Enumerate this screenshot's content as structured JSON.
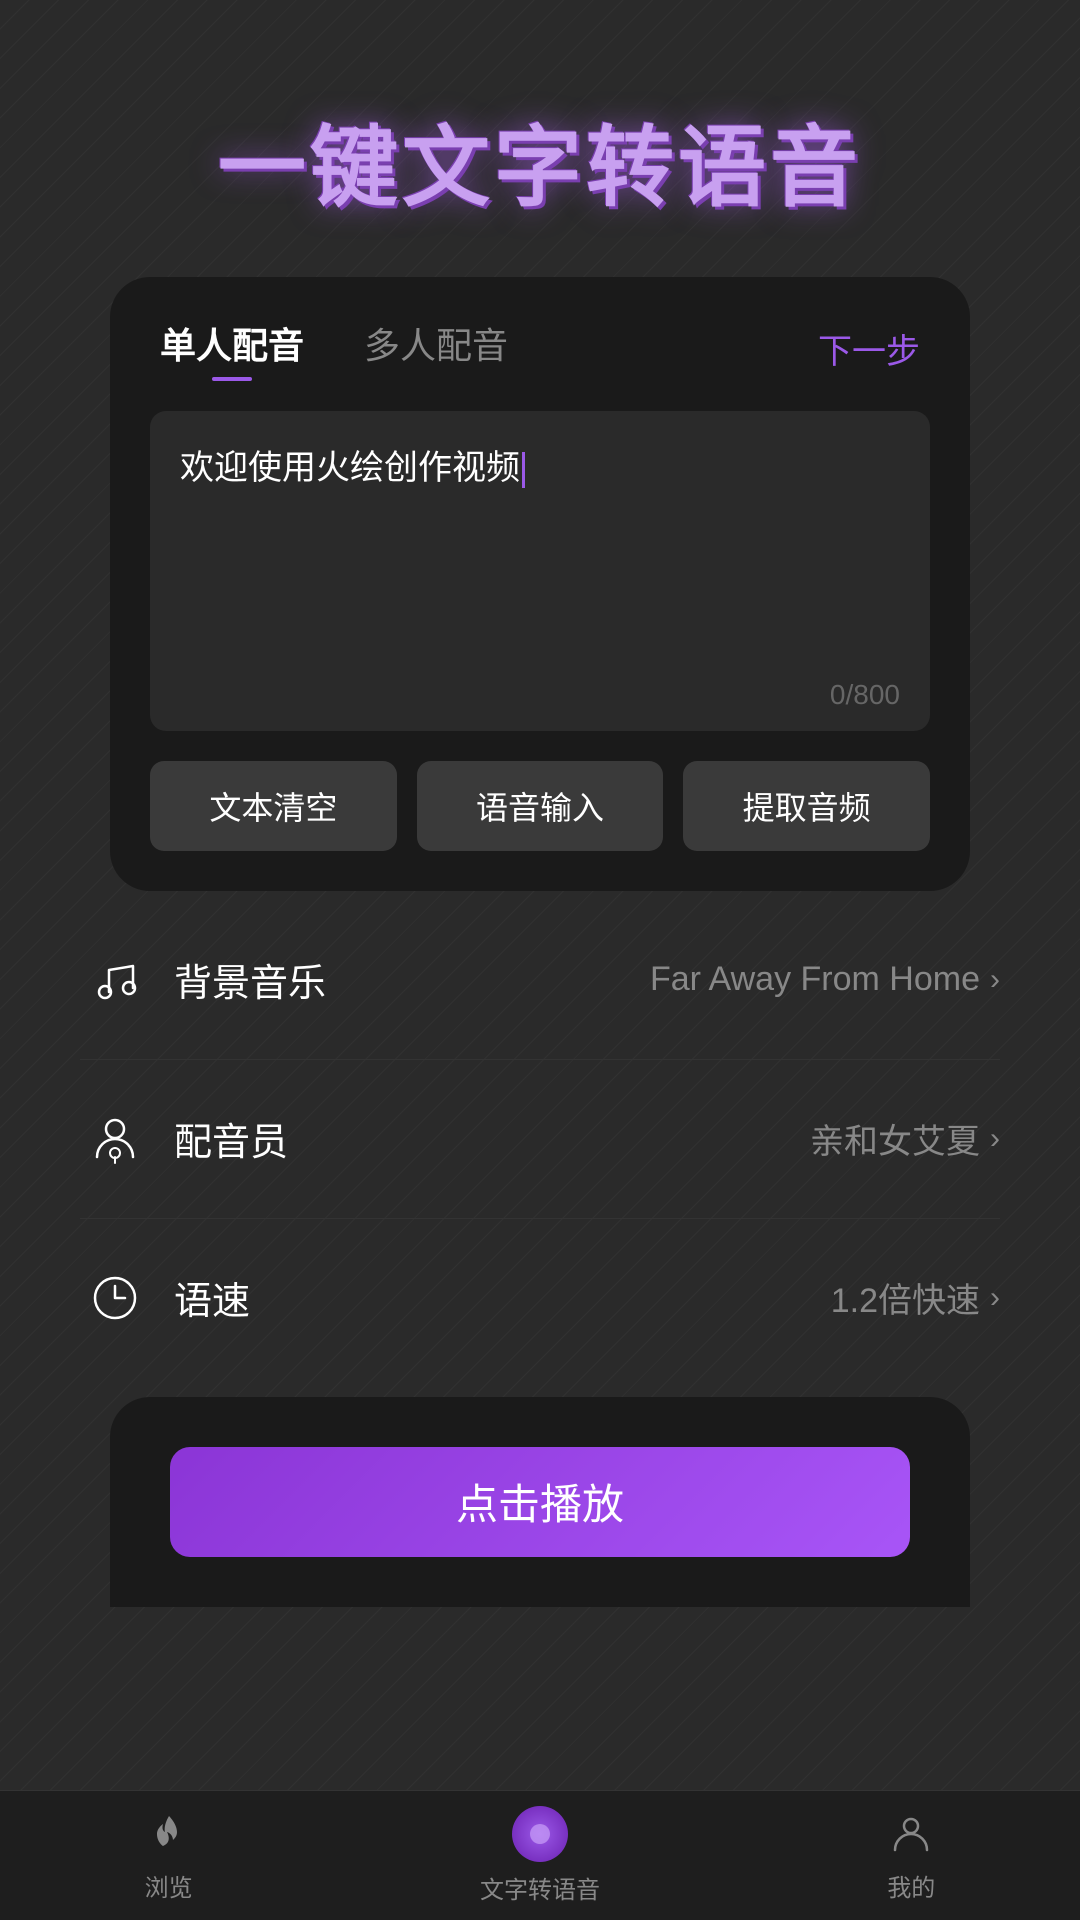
{
  "hero": {
    "title": "一键文字转语音"
  },
  "tabs": {
    "tab1": "单人配音",
    "tab2": "多人配音",
    "next": "下一步"
  },
  "editor": {
    "content": "欢迎使用火绘创作视频",
    "charCount": "0/800"
  },
  "buttons": {
    "clear": "文本清空",
    "voice_input": "语音输入",
    "extract_audio": "提取音频"
  },
  "settings": {
    "bgm": {
      "label": "背景音乐",
      "value": "Far Away From Home"
    },
    "dubber": {
      "label": "配音员",
      "value": "亲和女艾夏"
    },
    "speed": {
      "label": "语速",
      "value": "1.2倍快速"
    }
  },
  "playButton": {
    "label": "点击播放"
  },
  "nav": {
    "items": [
      {
        "label": "浏览",
        "icon": "flame-icon",
        "active": false
      },
      {
        "label": "文字转语音",
        "icon": "tts-icon",
        "active": true
      },
      {
        "label": "我的",
        "icon": "profile-icon",
        "active": false
      }
    ]
  }
}
